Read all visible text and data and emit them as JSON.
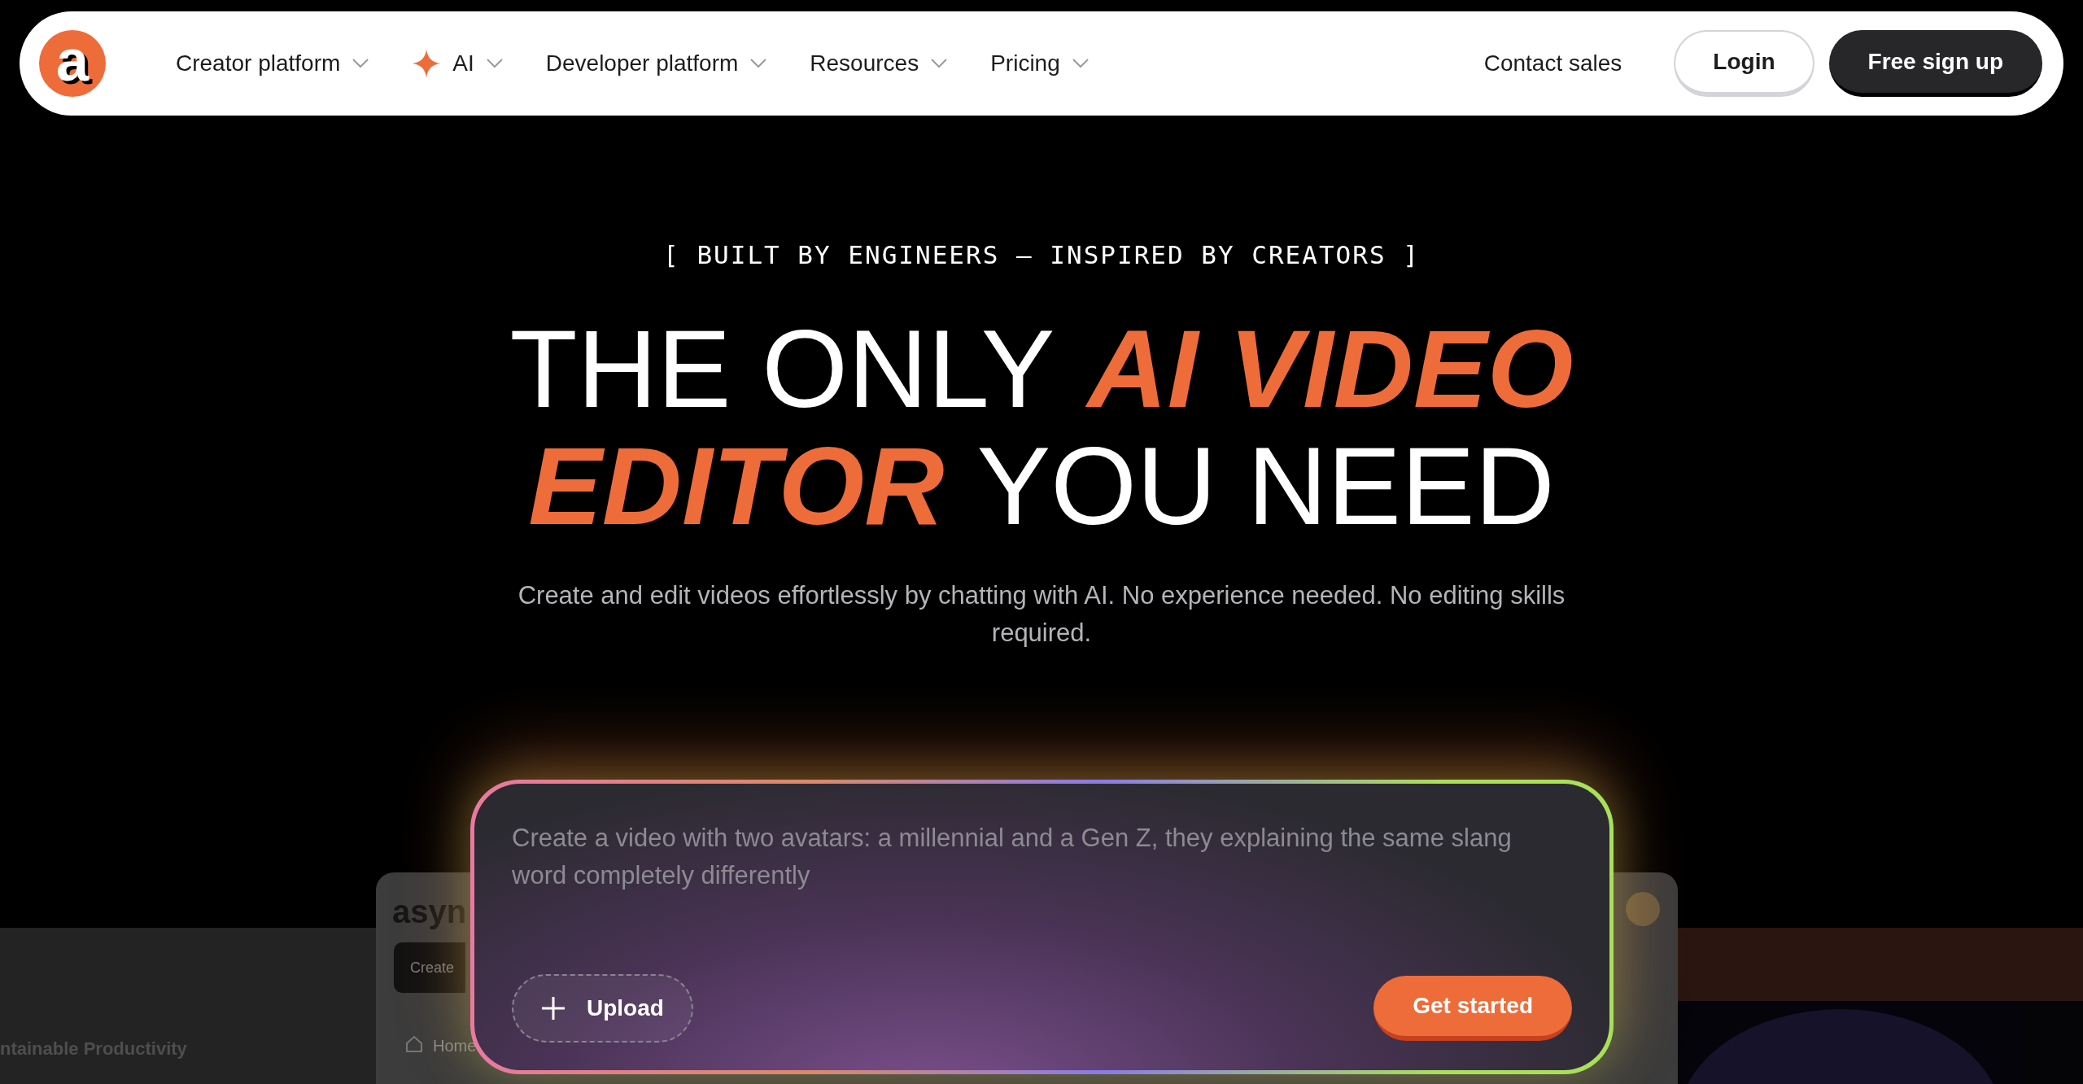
{
  "nav": {
    "logo": "a",
    "items": [
      {
        "label": "Creator platform",
        "kind": "plain",
        "has_dropdown": true
      },
      {
        "label": "AI",
        "kind": "featured",
        "has_dropdown": true
      },
      {
        "label": "Developer platform",
        "kind": "plain",
        "has_dropdown": true
      },
      {
        "label": "Resources",
        "kind": "plain",
        "has_dropdown": true
      },
      {
        "label": "Pricing",
        "kind": "plain",
        "has_dropdown": true
      }
    ],
    "contact": "Contact sales",
    "login": "Login",
    "signup": "Free sign up"
  },
  "hero": {
    "tagline": "[ BUILT BY ENGINEERS — INSPIRED BY CREATORS ]",
    "headline": [
      [
        {
          "text": "THE ONLY",
          "accent": false
        },
        {
          "text": "AI VIDEO",
          "accent": true
        }
      ],
      [
        {
          "text": "EDITOR",
          "accent": true
        },
        {
          "text": "YOU NEED",
          "accent": false
        }
      ]
    ],
    "subtitle": "Create and edit videos effortlessly by chatting with AI. No experience needed. No editing skills required."
  },
  "prompt": {
    "placeholder": "Create a video with two avatars: a millennial and a Gen Z, they explaining the same slang word completely differently",
    "upload": "Upload",
    "submit": "Get started"
  },
  "background_app": {
    "left_heading": "ntainable Productivity",
    "logo": "asyn",
    "create": "Create",
    "home": "Home"
  }
}
